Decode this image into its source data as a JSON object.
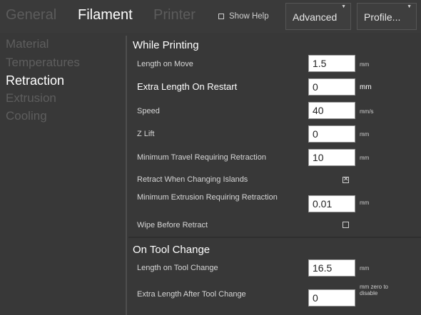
{
  "header": {
    "tabs": [
      {
        "label": "General"
      },
      {
        "label": "Filament"
      },
      {
        "label": "Printer"
      }
    ],
    "show_help_label": "Show Help",
    "advanced_label": "Advanced",
    "profile_label": "Profile...",
    "dropdown_arrow": "▼"
  },
  "sidebar": {
    "items": [
      {
        "label": "Material"
      },
      {
        "label": "Temperatures"
      },
      {
        "label": "Retraction"
      },
      {
        "label": "Extrusion"
      },
      {
        "label": "Cooling"
      }
    ]
  },
  "sections": [
    {
      "title": "While Printing",
      "rows": [
        {
          "label": "Length on Move",
          "value": "1.5",
          "unit": "mm"
        },
        {
          "label": "Extra Length On Restart",
          "value": "0",
          "unit": "mm"
        },
        {
          "label": "Speed",
          "value": "40",
          "unit": "mm/s"
        },
        {
          "label": "Z Lift",
          "value": "0",
          "unit": "mm"
        },
        {
          "label": "Minimum Travel Requiring Retraction",
          "value": "10",
          "unit": "mm"
        },
        {
          "label": "Retract When Changing Islands",
          "checked": true
        },
        {
          "label": "Minimum Extrusion Requiring Retraction",
          "value": "0.01",
          "unit": "mm"
        },
        {
          "label": "Wipe Before Retract",
          "checked": false
        }
      ]
    },
    {
      "title": "On Tool Change",
      "rows": [
        {
          "label": "Length on Tool Change",
          "value": "16.5",
          "unit": "mm"
        },
        {
          "label": "Extra Length After Tool Change",
          "value": "0",
          "unit": "mm zero to disable"
        }
      ]
    }
  ]
}
